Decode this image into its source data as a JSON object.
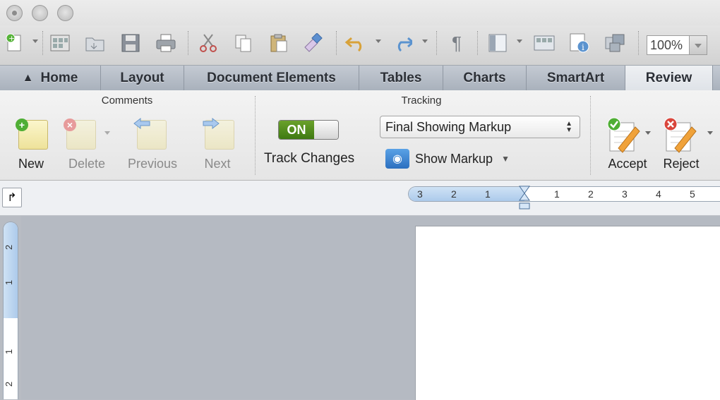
{
  "toolbar": {
    "icons": [
      "new-document-icon",
      "templates-icon",
      "open-icon",
      "save-icon",
      "print-icon",
      "cut-icon",
      "copy-icon",
      "paste-icon",
      "format-painter-icon",
      "undo-icon",
      "redo-icon",
      "pilcrow-icon",
      "sidebar-icon",
      "gallery-icon",
      "toolbox-icon",
      "media-browser-icon"
    ],
    "pilcrow": "¶",
    "zoom": "100%"
  },
  "tabs": [
    "Home",
    "Layout",
    "Document Elements",
    "Tables",
    "Charts",
    "SmartArt",
    "Review"
  ],
  "active_tab": "Review",
  "comments": {
    "title": "Comments",
    "new": "New",
    "delete": "Delete",
    "previous": "Previous",
    "next": "Next"
  },
  "tracking": {
    "title": "Tracking",
    "toggle": "ON",
    "track_changes": "Track Changes",
    "markup_select": "Final Showing Markup",
    "show_markup": "Show Markup"
  },
  "changes": {
    "accept": "Accept",
    "reject": "Reject"
  },
  "ruler": {
    "h_labels": [
      "3",
      "2",
      "1",
      "1",
      "2",
      "3",
      "4",
      "5"
    ],
    "v_labels": [
      "2",
      "1",
      "1",
      "2"
    ]
  },
  "colors": {
    "toggle_on": "#4f8a1b",
    "selected_tab": "#e6e9ee",
    "note": "#f3eaa8"
  }
}
